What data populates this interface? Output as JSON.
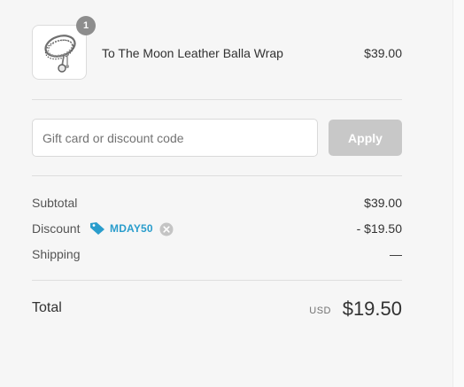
{
  "product": {
    "quantity": "1",
    "name": "To The Moon Leather Balla Wrap",
    "price": "$39.00",
    "image_icon": "bracelet-thumbnail"
  },
  "discount_form": {
    "placeholder": "Gift card or discount code",
    "value": "",
    "apply_label": "Apply"
  },
  "summary": {
    "subtotal_label": "Subtotal",
    "subtotal_value": "$39.00",
    "discount_label": "Discount",
    "discount_code": "MDAY50",
    "discount_value": "- $19.50",
    "shipping_label": "Shipping",
    "shipping_value": "—"
  },
  "total": {
    "label": "Total",
    "currency": "USD",
    "amount": "$19.50"
  },
  "colors": {
    "accent": "#2a9dcc",
    "apply_disabled": "#c8c8c8",
    "badge": "#8d8d8d"
  }
}
